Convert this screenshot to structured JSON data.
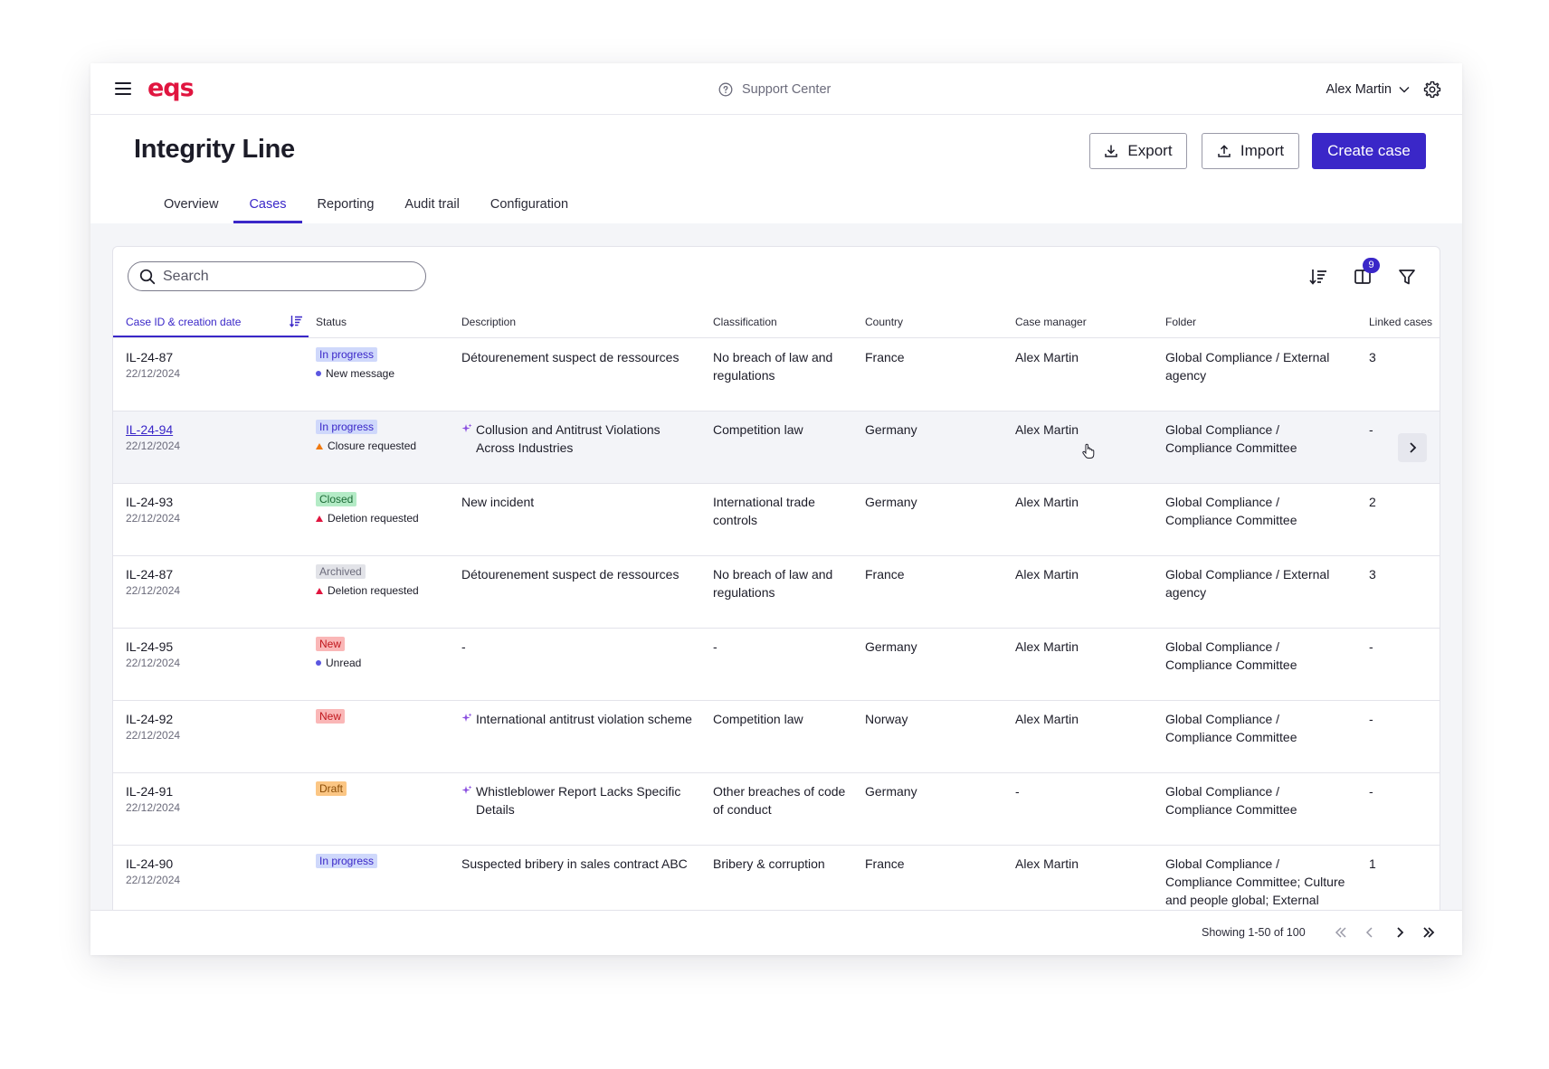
{
  "topbar": {
    "logo": "eqs",
    "support": "Support Center",
    "user": "Alex Martin"
  },
  "header": {
    "title": "Integrity Line",
    "export": "Export",
    "import": "Import",
    "create": "Create case",
    "tabs": [
      "Overview",
      "Cases",
      "Reporting",
      "Audit trail",
      "Configuration"
    ],
    "active_tab": "Cases"
  },
  "toolbar": {
    "search_placeholder": "Search",
    "columns_badge": "9"
  },
  "table": {
    "columns": [
      "Case ID & creation date",
      "Status",
      "Description",
      "Classification",
      "Country",
      "Case manager",
      "Folder",
      "Linked cases"
    ],
    "rows": [
      {
        "id": "IL-24-87",
        "date": "22/12/2024",
        "status": "In progress",
        "status_kind": "inprogress",
        "sub": "New message",
        "sub_kind": "dot",
        "desc": "Détourenement suspect de ressources",
        "ai": false,
        "class": "No breach of law and regulations",
        "country": "France",
        "manager": "Alex Martin",
        "folder": "Global Compliance / External agency",
        "linked": "3"
      },
      {
        "id": "IL-24-94",
        "date": "22/12/2024",
        "status": "In progress",
        "status_kind": "inprogress",
        "sub": "Closure requested",
        "sub_kind": "orange",
        "desc": "Collusion and Antitrust Violations Across Industries",
        "ai": true,
        "class": "Competition law",
        "country": "Germany",
        "manager": "Alex Martin",
        "folder": "Global Compliance / Compliance Committee",
        "linked": "-"
      },
      {
        "id": "IL-24-93",
        "date": "22/12/2024",
        "status": "Closed",
        "status_kind": "closed",
        "sub": "Deletion requested",
        "sub_kind": "red",
        "desc": "New incident",
        "ai": false,
        "class": "International trade controls",
        "country": "Germany",
        "manager": "Alex Martin",
        "folder": "Global Compliance / Compliance Committee",
        "linked": "2"
      },
      {
        "id": "IL-24-87",
        "date": "22/12/2024",
        "status": "Archived",
        "status_kind": "archived",
        "sub": "Deletion requested",
        "sub_kind": "red",
        "desc": "Détourenement suspect de ressources",
        "ai": false,
        "class": "No breach of law and regulations",
        "country": "France",
        "manager": "Alex Martin",
        "folder": "Global Compliance / External agency",
        "linked": "3"
      },
      {
        "id": "IL-24-95",
        "date": "22/12/2024",
        "status": "New",
        "status_kind": "new",
        "sub": "Unread",
        "sub_kind": "dot",
        "desc": "-",
        "ai": false,
        "class": "-",
        "country": "Germany",
        "manager": "Alex Martin",
        "folder": "Global Compliance / Compliance Committee",
        "linked": "-"
      },
      {
        "id": "IL-24-92",
        "date": "22/12/2024",
        "status": "New",
        "status_kind": "new",
        "sub": "",
        "sub_kind": "",
        "desc": "International antitrust violation scheme",
        "ai": true,
        "class": "Competition law",
        "country": "Norway",
        "manager": "Alex Martin",
        "folder": "Global Compliance / Compliance Committee",
        "linked": "-"
      },
      {
        "id": "IL-24-91",
        "date": "22/12/2024",
        "status": "Draft",
        "status_kind": "draft",
        "sub": "",
        "sub_kind": "",
        "desc": "Whistleblower Report Lacks Specific Details",
        "ai": true,
        "class": "Other breaches of code of conduct",
        "country": "Germany",
        "manager": "-",
        "folder": "Global Compliance / Compliance Committee",
        "linked": "-"
      },
      {
        "id": "IL-24-90",
        "date": "22/12/2024",
        "status": "In progress",
        "status_kind": "inprogress",
        "sub": "",
        "sub_kind": "",
        "desc": "Suspected bribery in sales contract ABC",
        "ai": false,
        "class": "Bribery & corruption",
        "country": "France",
        "manager": "Alex Martin",
        "folder": "Global Compliance / Compliance Committee; Culture and people global; External ag...",
        "linked": "1"
      }
    ]
  },
  "pagination": {
    "showing": "Showing 1-50 of 100"
  },
  "colors": {
    "accent": "#3a27c8",
    "brand": "#e0153f"
  }
}
